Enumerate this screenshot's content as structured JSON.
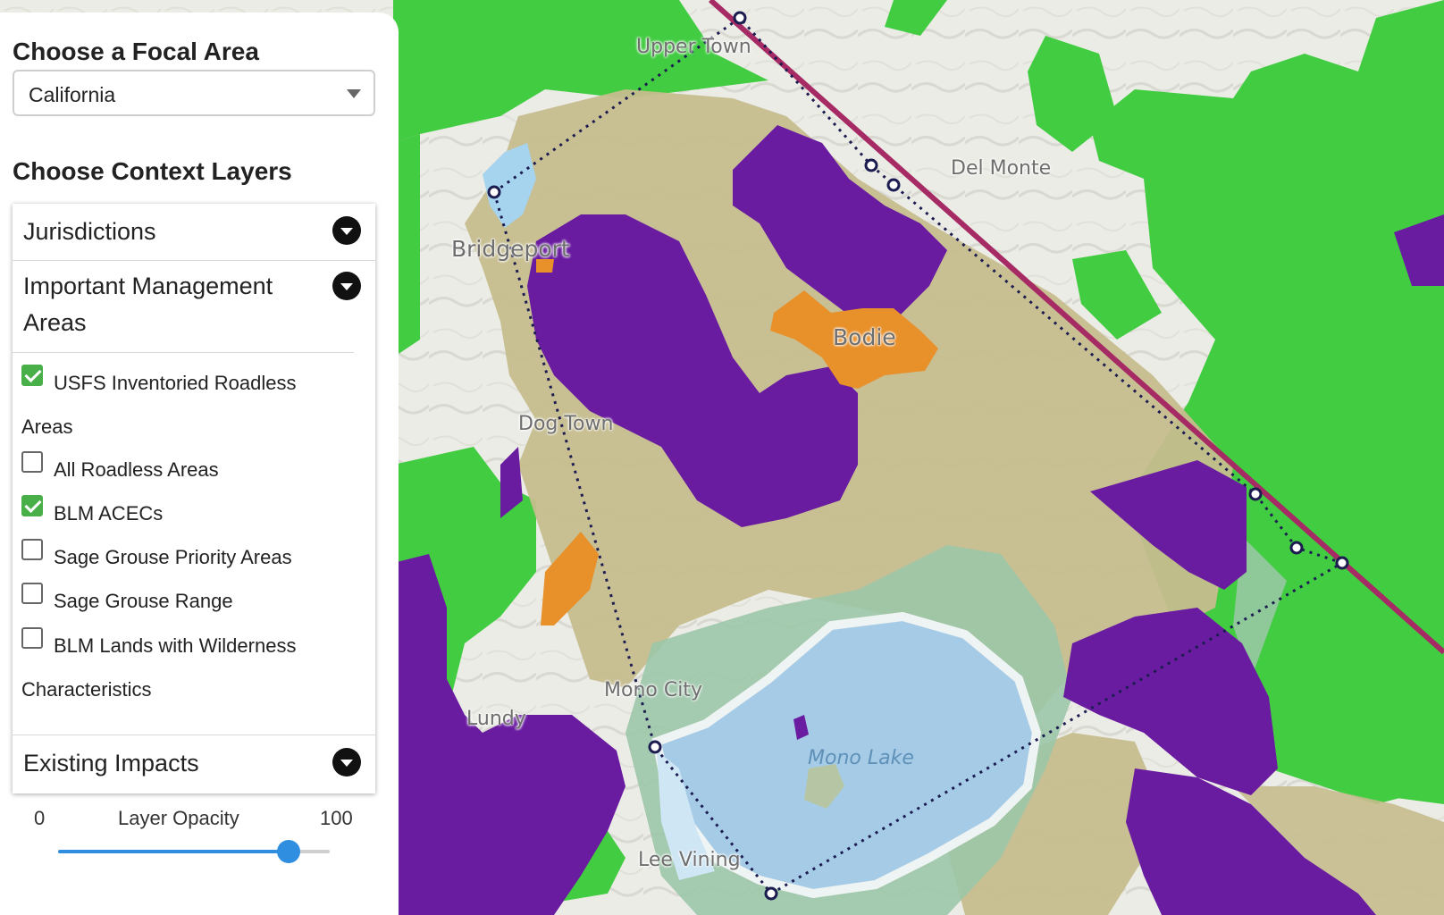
{
  "sidebar": {
    "focal_title": "Choose a Focal Area",
    "focal_value": "California",
    "context_title": "Choose Context Layers",
    "sections": {
      "jurisdictions": "Jurisdictions",
      "important_management_line1": "Important Management",
      "important_management_line2": "Areas",
      "existing_impacts": "Existing Impacts"
    },
    "layers": [
      {
        "label": "USFS Inventoried Roadless",
        "label_cont": "Areas",
        "checked": true
      },
      {
        "label": "All Roadless Areas",
        "checked": false
      },
      {
        "label": "BLM ACECs",
        "checked": true
      },
      {
        "label": "Sage Grouse Priority Areas",
        "checked": false
      },
      {
        "label": "Sage Grouse Range",
        "checked": false
      },
      {
        "label": "BLM Lands with Wilderness",
        "label_cont": "Characteristics",
        "checked": false
      }
    ],
    "opacity": {
      "label": "Layer Opacity",
      "min": "0",
      "max": "100",
      "value": 85
    }
  },
  "map": {
    "place_labels": {
      "upper_town": "Upper Town",
      "del_monte": "Del Monte",
      "bridgeport": "Bridgeport",
      "bodie": "Bodie",
      "dog_town": "Dog Town",
      "mono_city": "Mono City",
      "lundy": "Lundy",
      "mono_lake": "Mono Lake",
      "lee_vining": "Lee Vining"
    },
    "colors": {
      "forest_green": "#42cc42",
      "roadless_purple": "#6a1ca0",
      "acec_orange": "#e8902a",
      "blm_tan": "#c6bd8e",
      "lake_blue": "#a6cbe6",
      "teal": "#9cc7a8",
      "state_line": "#a62a64",
      "aoi_dash": "#1c1c50"
    }
  }
}
